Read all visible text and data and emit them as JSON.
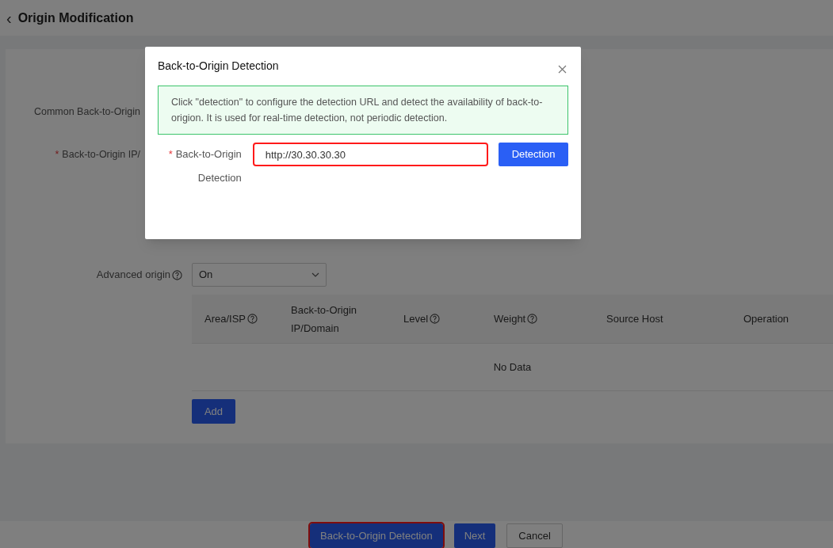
{
  "header": {
    "back_icon": "‹",
    "title": "Origin Modification"
  },
  "form": {
    "rows": [
      {
        "label": "Common Back-to-Origin"
      },
      {
        "required_mark": "*",
        "label": "Back-to-Origin IP/"
      }
    ],
    "advanced": {
      "label": "Advanced origin",
      "value": "On"
    }
  },
  "table": {
    "columns": [
      {
        "label": "Area/ISP",
        "help": true
      },
      {
        "label": "Back-to-Origin IP/Domain",
        "help": false
      },
      {
        "label": "Level",
        "help": true
      },
      {
        "label": "Weight",
        "help": true
      },
      {
        "label": "Source Host",
        "help": false
      },
      {
        "label": "Operation",
        "help": false
      }
    ],
    "empty": "No Data"
  },
  "add_button": "Add",
  "footer": {
    "buttons": [
      {
        "label": "Back-to-Origin Detection",
        "kind": "primary",
        "highlighted": true
      },
      {
        "label": "Next",
        "kind": "primary",
        "highlighted": false
      },
      {
        "label": "Cancel",
        "kind": "default",
        "highlighted": false
      }
    ]
  },
  "dialog": {
    "title": "Back-to-Origin Detection",
    "notice": "Click \"detection\" to configure the detection URL and detect the availability of back-to-origion. It is used for real-time detection, not periodic detection.",
    "field": {
      "label": "Back-to-Origin Detection",
      "required_mark": "*",
      "value": "http://30.30.30.30",
      "highlighted": true
    },
    "button": "Detection"
  }
}
